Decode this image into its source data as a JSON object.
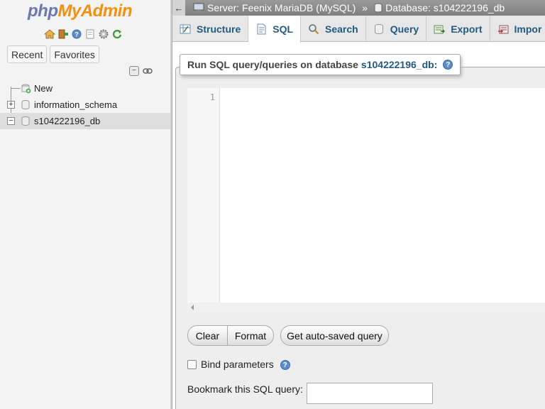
{
  "nav": {
    "logo_part1": "php",
    "logo_part2": "MyAdmin",
    "icons": [
      "home-icon",
      "exit-icon",
      "help-icon",
      "docs-icon",
      "settings-icon",
      "reload-icon"
    ],
    "recent_label": "Recent",
    "favorites_label": "Favorites",
    "tree": [
      {
        "label": "New",
        "icon": "new-db-icon",
        "expander": "",
        "selected": false
      },
      {
        "label": "information_schema",
        "icon": "database-icon",
        "expander": "+",
        "selected": false
      },
      {
        "label": "s104222196_db",
        "icon": "database-icon",
        "expander": "−",
        "selected": true
      }
    ]
  },
  "topbar": {
    "back_arrow": "←",
    "server_label": "Server: Feenix MariaDB (MySQL)",
    "separator": "»",
    "database_label": "Database: s104222196_db"
  },
  "tabs": [
    {
      "label": "Structure",
      "icon": "structure-icon",
      "active": false
    },
    {
      "label": "SQL",
      "icon": "sql-icon",
      "active": true
    },
    {
      "label": "Search",
      "icon": "search-icon",
      "active": false
    },
    {
      "label": "Query",
      "icon": "query-icon",
      "active": false
    },
    {
      "label": "Export",
      "icon": "export-icon",
      "active": false
    },
    {
      "label": "Impor",
      "icon": "import-icon",
      "active": false
    }
  ],
  "main": {
    "legend_prefix": "Run SQL query/queries on database",
    "legend_db": "s104222196_db:",
    "line_number": "1",
    "clear_label": "Clear",
    "format_label": "Format",
    "autosave_label": "Get auto-saved query",
    "bind_label": "Bind parameters",
    "bookmark_label": "Bookmark this SQL query:",
    "bookmark_value": ""
  },
  "colors": {
    "link": "#235a81",
    "logo_php": "#6c78af",
    "logo_myadmin": "#f29111",
    "topbar": "#8e8e8e"
  }
}
